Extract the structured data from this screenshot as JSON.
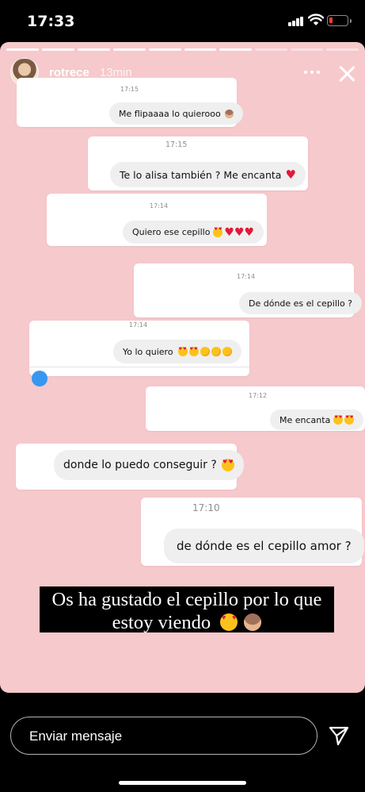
{
  "status_bar": {
    "time": "17:33"
  },
  "story": {
    "username": "rotrece",
    "time_ago": "13min",
    "progress": {
      "total_segments": 10,
      "completed_segments": 7
    },
    "screenshots": [
      {
        "timestamp": "17:15",
        "message": "Me flipaaaa lo quierooo",
        "emoji": [
          "monkey"
        ]
      },
      {
        "timestamp": "17:15",
        "message": "Te lo alisa también ? Me encanta",
        "emoji": [
          "heart"
        ]
      },
      {
        "timestamp": "17:14",
        "message": "Quiero ese cepillo",
        "emoji": [
          "love",
          "heart",
          "heart",
          "heart"
        ]
      },
      {
        "timestamp": "17:14",
        "message": "De dónde es el cepillo ?",
        "emoji": []
      },
      {
        "timestamp": "17:14",
        "message": "Yo lo quiero",
        "emoji": [
          "love",
          "love",
          "drool",
          "drool",
          "drool"
        ]
      },
      {
        "timestamp": "17:12",
        "message": "Me encanta",
        "emoji": [
          "love",
          "love"
        ]
      },
      {
        "timestamp": "",
        "message": "donde lo puedo conseguir ?",
        "emoji": [
          "love"
        ]
      },
      {
        "timestamp": "17:10",
        "message": "de dónde es el cepillo amor ?",
        "emoji": []
      }
    ],
    "caption": "Os ha gustado  el cepillo por lo que estoy viendo",
    "caption_emoji": [
      "love",
      "monkey"
    ]
  },
  "reply": {
    "placeholder": "Enviar mensaje"
  },
  "colors": {
    "story_background": "#f6c9cc",
    "heart": "#e0193a",
    "bubble": "#efefef"
  }
}
